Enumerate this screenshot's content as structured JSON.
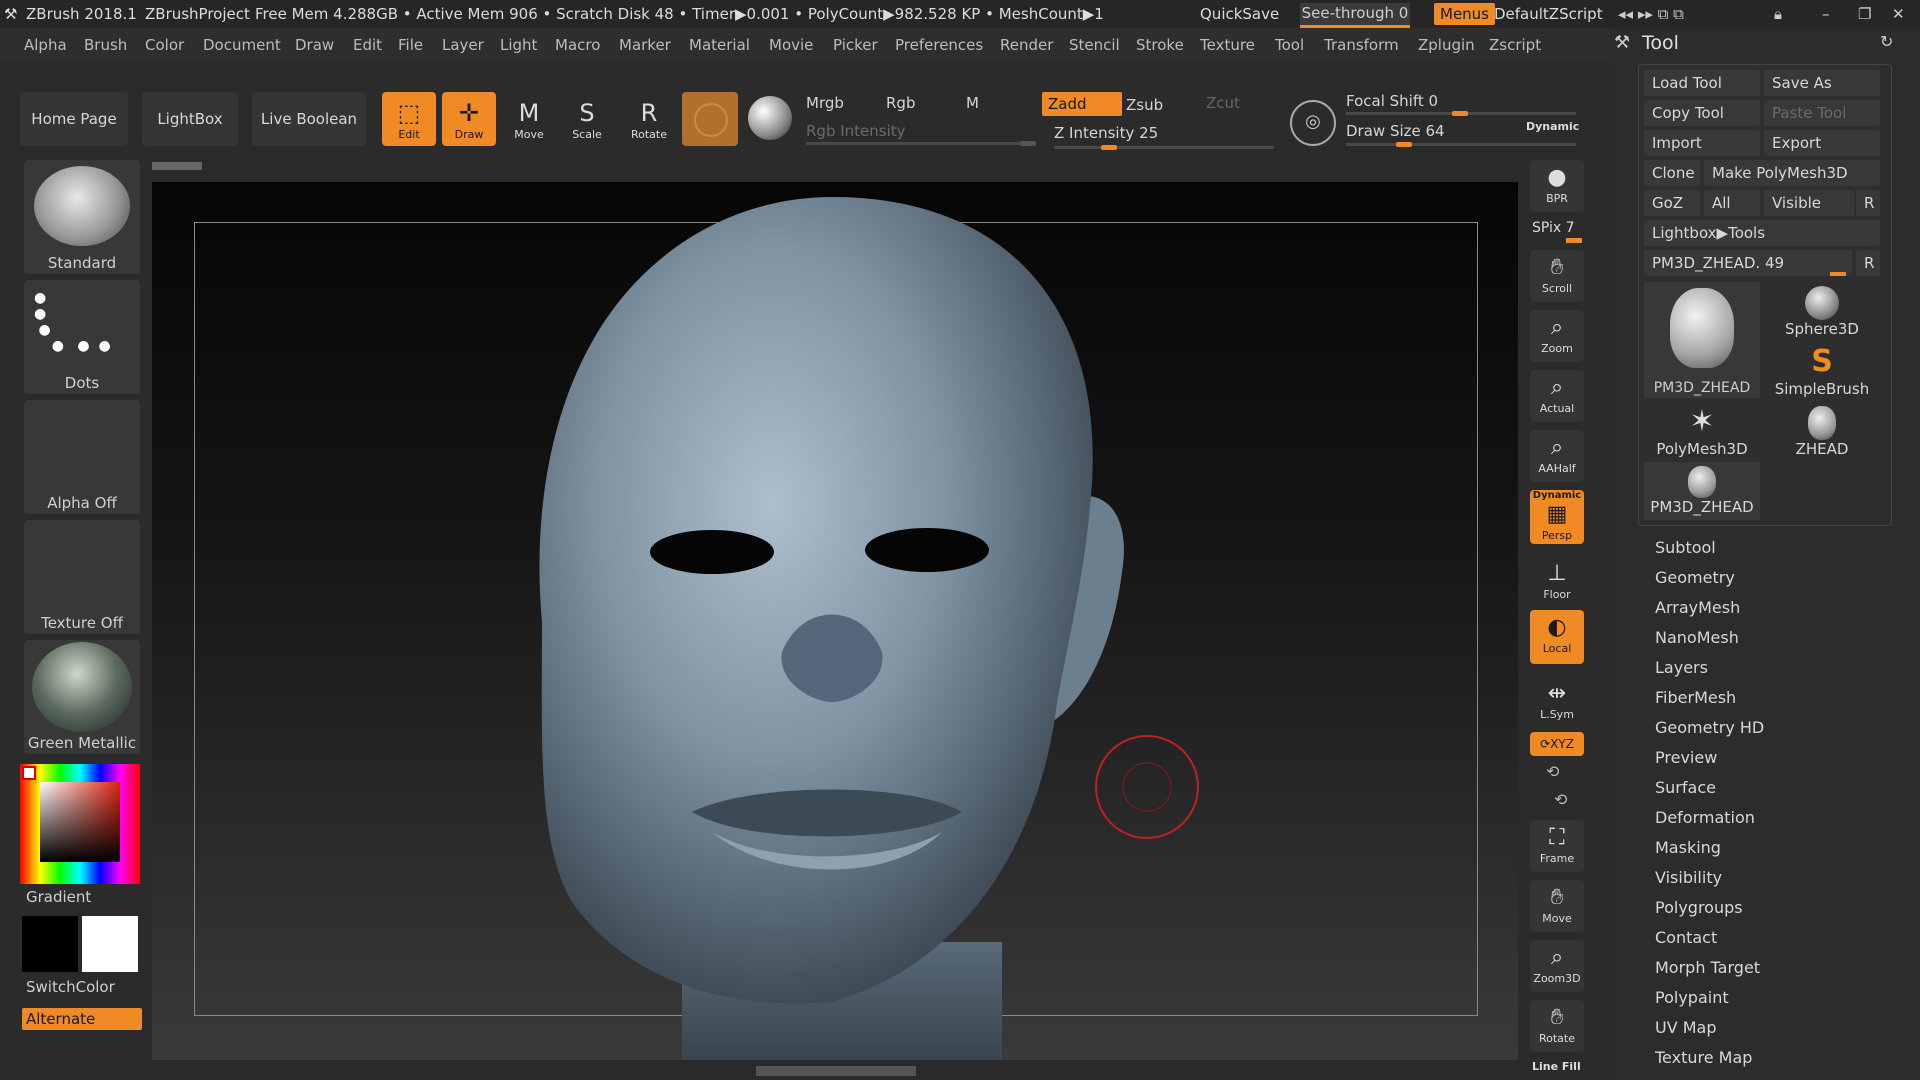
{
  "titlebar": {
    "app": "ZBrush 2018.1",
    "project": "ZBrushProject",
    "stats": "Free Mem 4.288GB • Active Mem 906 • Scratch Disk 48 • Timer▶0.001 • PolyCount▶982.528 KP • MeshCount▶1",
    "quicksave": "QuickSave",
    "see_through": "See-through",
    "see_through_value": "0",
    "menus": "Menus",
    "script": "DefaultZScript"
  },
  "menubar": [
    "Alpha",
    "Brush",
    "Color",
    "Document",
    "Draw",
    "Edit",
    "File",
    "Layer",
    "Light",
    "Macro",
    "Marker",
    "Material",
    "Movie",
    "Picker",
    "Preferences",
    "Render",
    "Stencil",
    "Stroke",
    "Texture",
    "Tool",
    "Transform",
    "Zplugin",
    "Zscript"
  ],
  "toolbar": {
    "home": "Home Page",
    "lightbox": "LightBox",
    "live_boolean": "Live Boolean",
    "edit": "Edit",
    "draw": "Draw",
    "move": "Move",
    "scale": "Scale",
    "rotate": "Rotate",
    "mrgb": "Mrgb",
    "rgb": "Rgb",
    "m": "M",
    "rgb_intensity": "Rgb Intensity",
    "zadd": "Zadd",
    "zsub": "Zsub",
    "zcut": "Zcut",
    "z_intensity": "Z Intensity 25",
    "z_intensity_value": 25,
    "focal_shift": "Focal Shift 0",
    "draw_size": "Draw Size 64",
    "dynamic": "Dynamic"
  },
  "leftshelf": {
    "brush": "Standard",
    "stroke": "Dots",
    "alpha": "Alpha Off",
    "texture": "Texture Off",
    "material": "Green Metallic",
    "gradient": "Gradient",
    "switchcolor": "SwitchColor",
    "alternate": "Alternate"
  },
  "rightshelf": {
    "bpr": "BPR",
    "spix": "SPix 7",
    "scroll": "Scroll",
    "zoom": "Zoom",
    "actual": "Actual",
    "aahalf": "AAHalf",
    "dynamic": "Dynamic",
    "persp": "Persp",
    "floor": "Floor",
    "local": "Local",
    "lsym": "L.Sym",
    "xyz": "XYZ",
    "frame": "Frame",
    "move": "Move",
    "zoom3d": "Zoom3D",
    "rotate": "Rotate",
    "linefill": "Line Fill"
  },
  "toolpanel": {
    "title": "Tool",
    "load": "Load Tool",
    "saveas": "Save As",
    "copy": "Copy Tool",
    "paste": "Paste Tool",
    "import": "Import",
    "export": "Export",
    "clone": "Clone",
    "makepoly": "Make PolyMesh3D",
    "goz": "GoZ",
    "all": "All",
    "visible": "Visible",
    "r": "R",
    "lightbox_tools": "Lightbox▶Tools",
    "current": "PM3D_ZHEAD. 49",
    "thumbs": [
      "PM3D_ZHEAD",
      "Sphere3D",
      "SimpleBrush",
      "PolyMesh3D",
      "ZHEAD",
      "PM3D_ZHEAD"
    ],
    "sections": [
      "Subtool",
      "Geometry",
      "ArrayMesh",
      "NanoMesh",
      "Layers",
      "FiberMesh",
      "Geometry HD",
      "Preview",
      "Surface",
      "Deformation",
      "Masking",
      "Visibility",
      "Polygroups",
      "Contact",
      "Morph Target",
      "Polypaint",
      "UV Map",
      "Texture Map"
    ]
  }
}
